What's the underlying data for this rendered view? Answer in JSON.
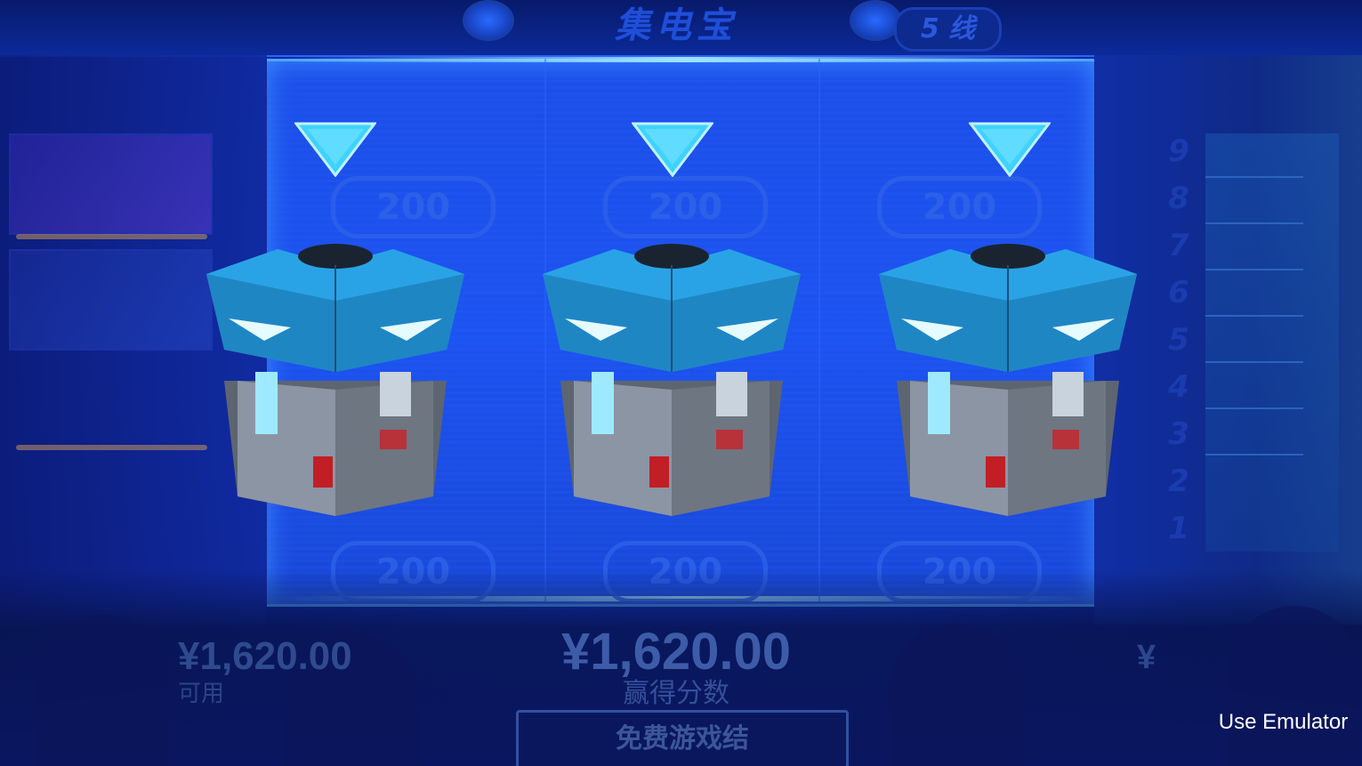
{
  "header": {
    "title": "集电宝",
    "lines_label": "5 线"
  },
  "reels": {
    "ghost_values": [
      "200",
      "200",
      "200",
      "200",
      "200",
      "200"
    ]
  },
  "paylines": {
    "numbers": [
      "9",
      "8",
      "7",
      "6",
      "5",
      "4",
      "3",
      "2",
      "1"
    ]
  },
  "balance": {
    "amount": "¥1,620.00",
    "label": "可用"
  },
  "win": {
    "amount": "¥1,620.00",
    "label": "赢得分数"
  },
  "bet": {
    "amount": "¥"
  },
  "free_game": {
    "label": "免费游戏结"
  },
  "emulator": {
    "label": "Use Emulator"
  },
  "colors": {
    "background": "#1238c4",
    "indicator": "#3fd2ff",
    "box_lid": "#2aa3e6",
    "box_body": "#8c95a3"
  },
  "icons": {
    "indicator": "triangle-down-icon",
    "prize": "loot-box-icon"
  }
}
